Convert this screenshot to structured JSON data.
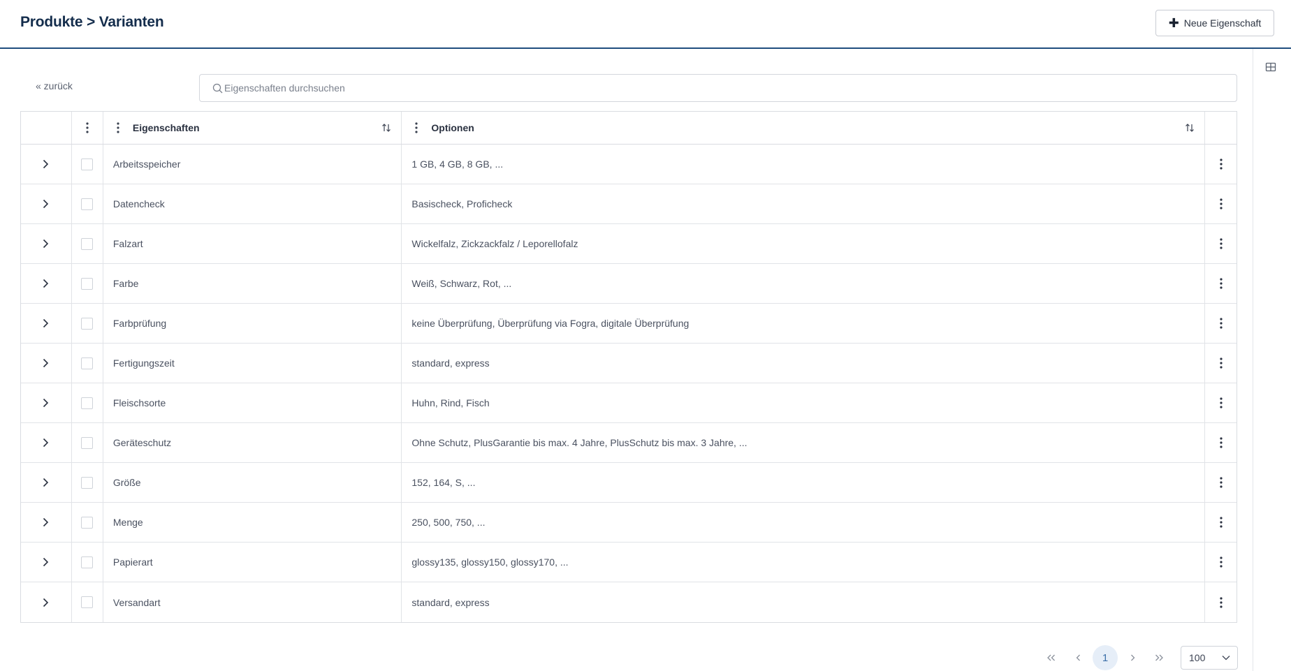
{
  "header": {
    "title": "Produkte > Varianten",
    "new_button_label": "Neue Eigenschaft",
    "new_button_icon": "plus-icon"
  },
  "toolbar": {
    "back_label": "« zurück",
    "search_placeholder": "Eigenschaften durchsuchen",
    "search_value": "",
    "search_icon": "search-icon",
    "layout_icon": "grid-view-icon"
  },
  "table": {
    "columns": [
      {
        "label": "Eigenschaften",
        "sortable": true
      },
      {
        "label": "Optionen",
        "sortable": true
      }
    ],
    "rows": [
      {
        "name": "Arbeitsspeicher",
        "options": "1 GB, 4 GB, 8 GB, ..."
      },
      {
        "name": "Datencheck",
        "options": "Basischeck, Proficheck"
      },
      {
        "name": "Falzart",
        "options": "Wickelfalz, Zickzackfalz / Leporellofalz"
      },
      {
        "name": "Farbe",
        "options": "Weiß, Schwarz, Rot, ..."
      },
      {
        "name": "Farbprüfung",
        "options": "keine Überprüfung, Überprüfung via Fogra, digitale Überprüfung"
      },
      {
        "name": "Fertigungszeit",
        "options": "standard, express"
      },
      {
        "name": "Fleischsorte",
        "options": "Huhn, Rind, Fisch"
      },
      {
        "name": "Geräteschutz",
        "options": "Ohne Schutz, PlusGarantie bis max. 4 Jahre, PlusSchutz bis max. 3 Jahre, ..."
      },
      {
        "name": "Größe",
        "options": "152, 164, S, ..."
      },
      {
        "name": "Menge",
        "options": "250, 500, 750, ..."
      },
      {
        "name": "Papierart",
        "options": "glossy135, glossy150, glossy170, ..."
      },
      {
        "name": "Versandart",
        "options": "standard, express"
      }
    ]
  },
  "pagination": {
    "first": "«",
    "prev": "‹",
    "current_page": "1",
    "next": "›",
    "last": "»",
    "page_size": "100"
  },
  "colors": {
    "title": "#142d4c",
    "header_rule": "#1f4d7e",
    "active_page_bg": "#e6eef8",
    "active_page_text": "#3b6fa8"
  }
}
